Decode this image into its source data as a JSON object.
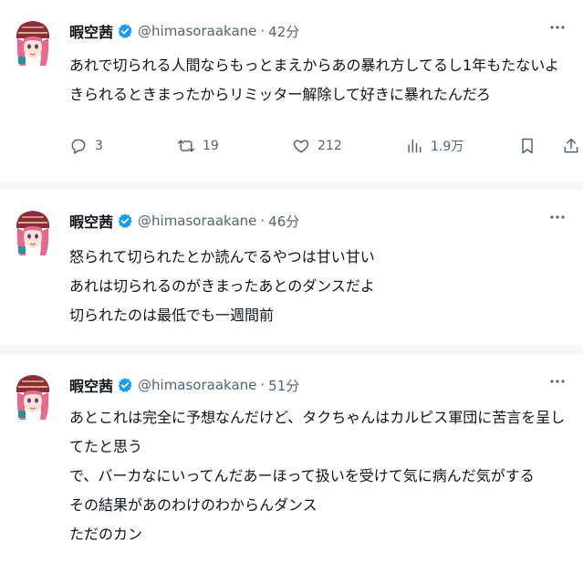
{
  "tweets": [
    {
      "name": "暇空茜",
      "handle": "@himasoraakane",
      "dot": "·",
      "time": "42分",
      "lines": [
        "あれで切られる人間ならもっとまえからあの暴れ方してるし1年もたないよ",
        "きられるときまったからリミッター解除して好きに暴れたんだろ"
      ],
      "replies": "3",
      "retweets": "19",
      "likes": "212",
      "views": "1.9万"
    },
    {
      "name": "暇空茜",
      "handle": "@himasoraakane",
      "dot": "·",
      "time": "46分",
      "lines": [
        "怒られて切られたとか読んでるやつは甘い甘い",
        "あれは切られるのがきまったあとのダンスだよ",
        "切られたのは最低でも一週間前"
      ]
    },
    {
      "name": "暇空茜",
      "handle": "@himasoraakane",
      "dot": "·",
      "time": "51分",
      "lines": [
        "あとこれは完全に予想なんだけど、タクちゃんはカルピス軍団に苦言を呈し",
        "てたと思う",
        "で、バーカなにいってんだあーほって扱いを受けて気に病んだ気がする",
        "その結果があのわけのわからんダンス",
        "ただのカン"
      ]
    }
  ],
  "colors": {
    "text": "#0f1419",
    "muted": "#536471",
    "verified": "#1d9bf0"
  },
  "icons": [
    "verified-badge-icon",
    "more-icon",
    "reply-icon",
    "retweet-icon",
    "like-icon",
    "views-icon",
    "bookmark-icon",
    "share-icon"
  ]
}
